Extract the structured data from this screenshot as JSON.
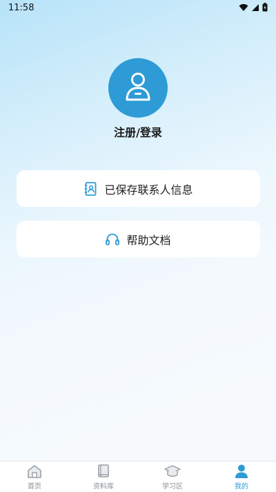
{
  "status_bar": {
    "time": "11:58"
  },
  "profile": {
    "login_label": "注册/登录"
  },
  "menu": [
    {
      "label": "已保存联系人信息",
      "icon": "contacts-book-icon"
    },
    {
      "label": "帮助文档",
      "icon": "headphones-icon"
    }
  ],
  "tabs": [
    {
      "label": "首页",
      "icon": "home-icon",
      "active": false
    },
    {
      "label": "资料库",
      "icon": "book-icon",
      "active": false
    },
    {
      "label": "学习区",
      "icon": "graduation-cap-icon",
      "active": false
    },
    {
      "label": "我的",
      "icon": "user-icon",
      "active": true
    }
  ],
  "colors": {
    "accent": "#2e9bd6",
    "inactive": "#8a8f96"
  }
}
